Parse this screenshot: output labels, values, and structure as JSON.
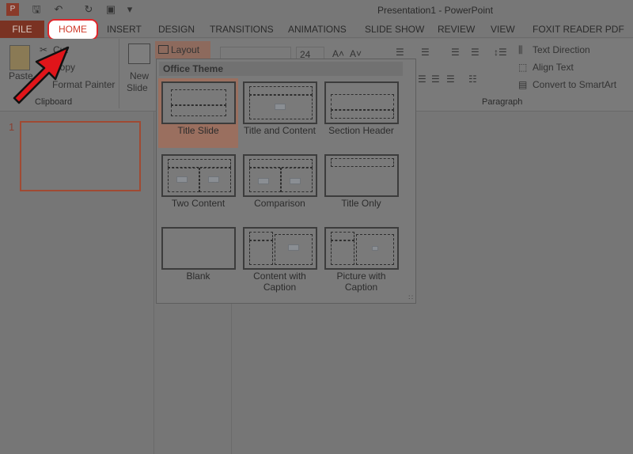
{
  "window": {
    "title": "Presentation1 - PowerPoint"
  },
  "quick_access": {
    "icons": [
      "powerpoint-logo-icon",
      "save-icon",
      "undo-icon",
      "redo-icon",
      "slideshow-from-start-icon",
      "customize-icon"
    ]
  },
  "tabs": [
    "FILE",
    "HOME",
    "INSERT",
    "DESIGN",
    "TRANSITIONS",
    "ANIMATIONS",
    "SLIDE SHOW",
    "REVIEW",
    "VIEW",
    "FOXIT READER PDF"
  ],
  "highlight": {
    "tab": "HOME",
    "color": "#e0252a"
  },
  "ribbon": {
    "clipboard": {
      "paste": "Paste",
      "cut": "Cut",
      "copy": "Copy",
      "format_painter": "Format Painter",
      "group": "Clipboard"
    },
    "slides": {
      "new_slide_1": "New",
      "new_slide_2": "Slide",
      "layout": "Layout"
    },
    "font": {
      "size": "24"
    },
    "paragraph": {
      "text_direction": "Text Direction",
      "align_text": "Align Text",
      "convert_smartart": "Convert to SmartArt",
      "group": "Paragraph"
    }
  },
  "slides_panel": {
    "slide_number": "1"
  },
  "layout_menu": {
    "header": "Office Theme",
    "items": [
      {
        "label": "Title Slide",
        "selected": true
      },
      {
        "label": "Title and Content"
      },
      {
        "label": "Section Header"
      },
      {
        "label": "Two Content"
      },
      {
        "label": "Comparison"
      },
      {
        "label": "Title Only"
      },
      {
        "label": "Blank"
      },
      {
        "label": "Content with Caption"
      },
      {
        "label": "Picture with Caption"
      }
    ]
  }
}
